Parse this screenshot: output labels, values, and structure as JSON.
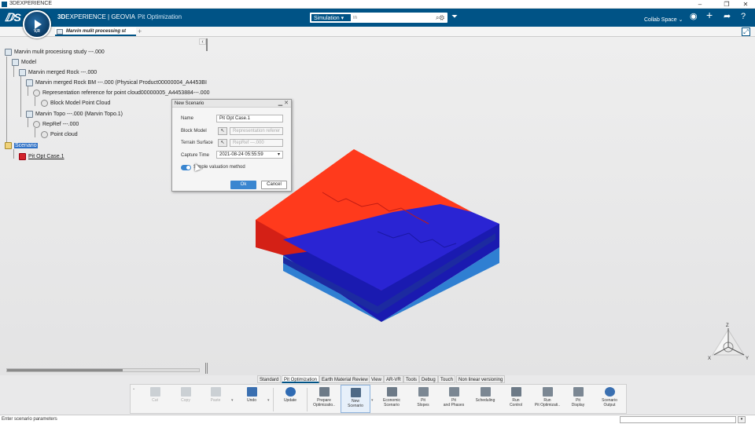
{
  "window": {
    "title": "3DEXPERIENCE",
    "controls": [
      "–",
      "❐",
      "✕"
    ]
  },
  "topbar": {
    "brand_prefix": "3D",
    "brand_main": "EXPERIENCE | GEOVIA",
    "app_name": "Pit Optimization",
    "compass_label": "V,R",
    "search_scope": "Simulation",
    "search_placeholder": "In",
    "collab_space": "Collab Space",
    "colors": {
      "bar": "#005386"
    }
  },
  "tabs": [
    {
      "label": "Marvin mulit processing st"
    }
  ],
  "tree": {
    "root": "Marvin mulit procesisng study ---.000",
    "model": "Model",
    "merged_rock": "Marvin merged Rock ---.000",
    "rock_bm": "Marvin merged Rock BM ---.000 (Physical Product00000004_A4453BI",
    "rep_ref": "Representation reference for point cloud00000005_A4453884---.000",
    "block_cloud": "Block Model Point Cloud",
    "topo": "Marvin Topo ---.000 (Marvin Topo.1)",
    "repref": "RepRef ---.000",
    "point_cloud": "Point cloud",
    "scenario": "Scenario",
    "pit_case": "Pit Opt Case.1"
  },
  "dialog": {
    "title": "New Scenario",
    "controls": [
      "▁",
      "✕"
    ],
    "name_label": "Name",
    "name_value": "Pit Opt Case.1",
    "block_label": "Block Model",
    "block_value": "Representation referer",
    "terrain_label": "Terrain Surface",
    "terrain_value": "RepRef ---.000",
    "capture_label": "Capture Time",
    "capture_value": "2021-08-24 05:55:59",
    "toggle_label": "Simple valuation method",
    "toggle_on": true,
    "ok": "Ok",
    "cancel": "Cancel"
  },
  "triad": {
    "x": "X",
    "y": "Y",
    "z": "Z"
  },
  "action_tabs": [
    "Standard",
    "Pit Optimization",
    "Earth Material Review",
    "View",
    "AR-VR",
    "Tools",
    "Debug",
    "Touch",
    "Non linear versioning"
  ],
  "action_tab_active": "Pit Optimization",
  "actions": {
    "cut": "Cut",
    "copy": "Copy",
    "paste": "Paste",
    "undo": "Undo",
    "update": "Update",
    "prepare_1": "Prepare",
    "prepare_2": "Optimizatio..",
    "new_1": "New",
    "new_2": "Scenario",
    "econ_1": "Economic",
    "econ_2": "Scenario",
    "slopes_1": "Pit",
    "slopes_2": "Slopes",
    "phases_1": "Pit",
    "phases_2": "and Phases",
    "scheduling": "Scheduling",
    "run_1": "Run",
    "run_2": "Control",
    "runopt_1": "Run",
    "runopt_2": "Pit Optimizati..",
    "display_1": "Pit",
    "display_2": "Display",
    "output_1": "Scenario",
    "output_2": "Output"
  },
  "status": {
    "text": "Enter scenario parameters"
  },
  "model_colors": {
    "ore_top": "#ff3b1f",
    "waste_top": "#2622d0",
    "side_dark": "#14129a",
    "base": "#2a7fd4"
  }
}
